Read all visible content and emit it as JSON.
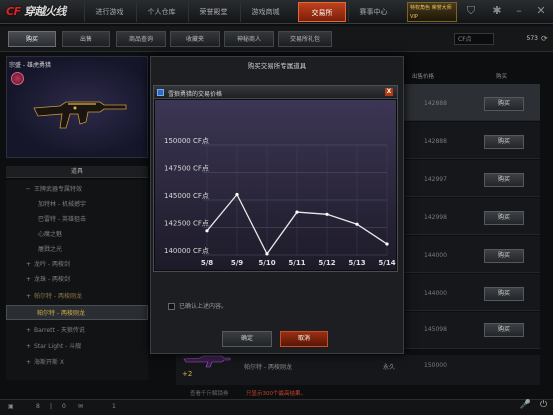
{
  "header": {
    "logo_text": "穿越火线",
    "logo_prefix": "CF",
    "nav": [
      {
        "label": "进行游戏"
      },
      {
        "label": "个人仓库"
      },
      {
        "label": "荣誉殿堂"
      },
      {
        "label": "游戏商城"
      },
      {
        "label": "交易所"
      },
      {
        "label": "赛事中心"
      }
    ],
    "user_badge": "特权角色 荣誉大师 VIP"
  },
  "subnav": {
    "tabs": [
      {
        "label": "购买"
      },
      {
        "label": "出售"
      },
      {
        "label": "商品查询"
      },
      {
        "label": "收藏夹"
      },
      {
        "label": "神秘商人"
      },
      {
        "label": "交易所礼包"
      }
    ],
    "cf_placeholder": "CF点",
    "cf_balance": "573"
  },
  "preview": {
    "title": "宗盛 - 雄虎勇猎"
  },
  "tree": {
    "header": "道具",
    "items": [
      {
        "label": "王牌武器专属特效",
        "exp": "─"
      },
      {
        "label": "加特林 - 机械撼宇",
        "exp": ""
      },
      {
        "label": "巴雷特 - 英雄狙击",
        "exp": ""
      },
      {
        "label": "心魔之魅",
        "exp": ""
      },
      {
        "label": "屠戮之光",
        "exp": ""
      },
      {
        "label": "龙吟 - 两棱剑",
        "exp": "+"
      },
      {
        "label": "龙珠 - 两棱剑",
        "exp": "+"
      },
      {
        "label": "帕尔特 - 两棱刚龙",
        "exp": "+"
      },
      {
        "label": "帕尔特 - 两棱刚龙",
        "exp": ""
      },
      {
        "label": "Barrett - 天狼传说",
        "exp": "+"
      },
      {
        "label": "Star Light - 斗舰",
        "exp": "+"
      },
      {
        "label": "海斯开斯 X",
        "exp": "+"
      }
    ]
  },
  "table": {
    "price_header": "出售价格",
    "buy_header": "购买",
    "buy_label": "购买",
    "rows": [
      {
        "price": "142888"
      },
      {
        "price": "142888"
      },
      {
        "price": "142997"
      },
      {
        "price": "142998"
      },
      {
        "price": "144000"
      },
      {
        "price": "144000"
      },
      {
        "price": "145098"
      },
      {
        "price": "150000"
      }
    ]
  },
  "modal": {
    "title": "购买交易所专属道具",
    "confirm_text": "已确认上述内容。",
    "ok_label": "确定",
    "cancel_label": "取消"
  },
  "chart_window": {
    "title": "雪狼勇猎的交易价格",
    "close": "X"
  },
  "chart_data": {
    "type": "line",
    "x": [
      "5/8",
      "5/9",
      "5/10",
      "5/11",
      "5/12",
      "5/13",
      "5/14"
    ],
    "values": [
      142200,
      145500,
      140100,
      143900,
      143700,
      142800,
      141000
    ],
    "y_ticks": [
      "150000 CF点",
      "147500 CF点",
      "145000 CF点",
      "142500 CF点",
      "140000 CF点"
    ],
    "ylim": [
      140000,
      150000
    ],
    "line_color": "#e8e8e8",
    "grid": true
  },
  "bottom": {
    "plus": "+2",
    "item_name": "帕尔特 - 两棱刚龙",
    "duration": "永久",
    "price": "150000",
    "note_left": "查看千斤解锁券",
    "note_right": "只显示300个最高结果。"
  },
  "statusbar": {
    "items": [
      "8",
      "0",
      "1"
    ]
  }
}
